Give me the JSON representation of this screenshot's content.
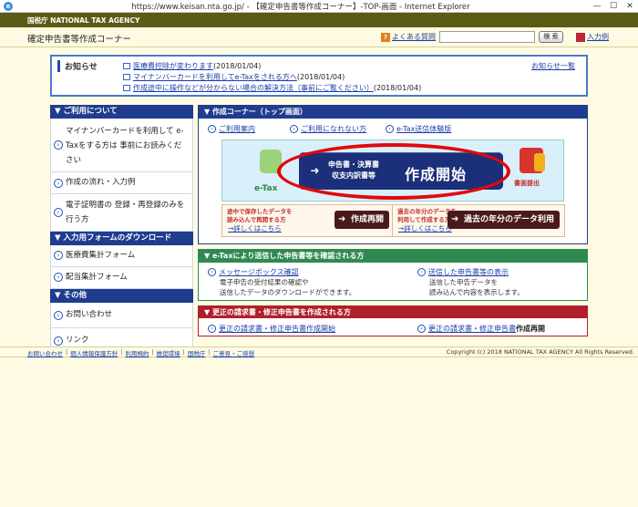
{
  "window": {
    "title": "https://www.keisan.nta.go.jp/ - 【確定申告書等作成コーナー】-TOP-画面 - Internet Explorer",
    "controls": [
      "—",
      "☐",
      "✕"
    ]
  },
  "header": {
    "agency": "国税庁 NATIONAL TAX AGENCY",
    "site_title": "確定申告書等作成コーナー",
    "faq_label": "よくある質問",
    "search_placeholder": "",
    "search_button": "検 索",
    "entry_label": "入力例"
  },
  "news": {
    "label": "お知らせ",
    "more": "お知らせ一覧",
    "items": [
      {
        "link": "医療費控除が変わります",
        "date": "(2018/01/04)"
      },
      {
        "link": "マイナンバーカードを利用してe-Taxをされる方へ",
        "date": "(2018/01/04)"
      },
      {
        "link": "作成途中に操作などが分からない場合の解決方法（事前にご覧ください）",
        "date": "(2018/01/04)"
      }
    ]
  },
  "sidebar": {
    "sections": [
      {
        "heading": "ご利用について",
        "items": [
          {
            "label": "マイナンバーカードを利用して e-Taxをする方は 事前にお読みください"
          },
          {
            "label": "作成の流れ・入力例"
          },
          {
            "label": "電子証明書の 登録・再登録のみを行う方"
          }
        ]
      },
      {
        "heading": "入力用フォームのダウンロード",
        "items": [
          {
            "label": "医療費集計フォーム"
          },
          {
            "label": "配当集計フォーム"
          }
        ]
      },
      {
        "heading": "その他",
        "items": [
          {
            "label": "お問い合わせ"
          },
          {
            "label": "リンク"
          }
        ]
      }
    ]
  },
  "main_panel": {
    "heading": "作成コーナー（トップ画面）",
    "links": [
      "ご利用案内",
      "ご利用になれない方",
      "e-Tax送信体験版"
    ],
    "etax_label": "e-Tax",
    "main_button_small": "申告書・決算書\n収支内訳書等",
    "main_button_big": "作成開始",
    "shomen_label": "書面提出",
    "resume": {
      "desc": "途中で保存したデータを\n読み込んで再開する方",
      "button": "作成再開",
      "more": "→詳しくはこちら"
    },
    "past": {
      "desc": "過去の年分のデータを\n利用して作成する方",
      "button": "過去の年分のデータ利用",
      "more": "→詳しくはこちら"
    }
  },
  "etax_panel": {
    "heading": "e-Taxにより送信した申告書等を確認される方",
    "left_title": "メッセージボックス確認",
    "left_desc": "電子申告の受付結果の確認や\n送信したデータのダウンロードができます。",
    "right_title": "送信した申告書等の表示",
    "right_desc": "送信した申告データを\n読み込んで内容を表示します。"
  },
  "correction_panel": {
    "heading": "更正の請求書・修正申告書を作成される方",
    "left_link": "更正の請求書・修正申告書作成開始",
    "right_link": "更正の請求書・修正申告書",
    "right_suffix": "作成再開"
  },
  "footer": {
    "links": [
      "お問い合わせ",
      "個人情報保護方針",
      "利用規約",
      "推奨環境",
      "国税庁",
      "ご意見・ご感想"
    ],
    "copyright": "Copyright (c) 2018 NATIONAL TAX AGENCY All Rights Reserved."
  }
}
